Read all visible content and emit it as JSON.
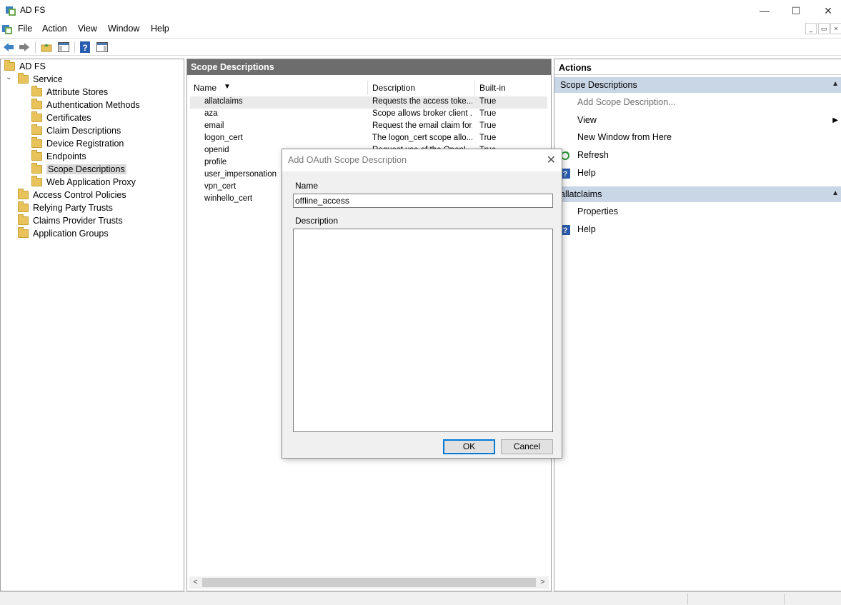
{
  "window": {
    "title": "AD FS",
    "minimize_glyph": "—",
    "maximize_glyph": "☐",
    "close_glyph": "✕"
  },
  "menu": {
    "items": [
      "File",
      "Action",
      "View",
      "Window",
      "Help"
    ]
  },
  "mdi": {
    "minimize_glyph": "_",
    "restore_glyph": "▭",
    "close_glyph": "×"
  },
  "tree": {
    "root": "AD FS",
    "service": "Service",
    "service_children": [
      "Attribute Stores",
      "Authentication Methods",
      "Certificates",
      "Claim Descriptions",
      "Device Registration",
      "Endpoints",
      "Scope Descriptions",
      "Web Application Proxy"
    ],
    "top_level": [
      "Access Control Policies",
      "Relying Party Trusts",
      "Claims Provider Trusts",
      "Application Groups"
    ],
    "selected": "Scope Descriptions"
  },
  "center": {
    "header": "Scope Descriptions",
    "columns": [
      "Name",
      "Description",
      "Built-in"
    ],
    "sort_glyph": "▼",
    "rows": [
      {
        "name": "allatclaims",
        "description": "Requests the access toke...",
        "builtin": "True"
      },
      {
        "name": "aza",
        "description": "Scope allows broker client ...",
        "builtin": "True"
      },
      {
        "name": "email",
        "description": "Request the email claim for...",
        "builtin": "True"
      },
      {
        "name": "logon_cert",
        "description": "The logon_cert scope allo...",
        "builtin": "True"
      },
      {
        "name": "openid",
        "description": "Request use of the OpenI...",
        "builtin": "True"
      },
      {
        "name": "profile",
        "description": "",
        "builtin": ""
      },
      {
        "name": "user_impersonation",
        "description": "",
        "builtin": ""
      },
      {
        "name": "vpn_cert",
        "description": "",
        "builtin": ""
      },
      {
        "name": "winhello_cert",
        "description": "",
        "builtin": ""
      }
    ],
    "scroll_left": "<",
    "scroll_right": ">"
  },
  "actions": {
    "title": "Actions",
    "section1": {
      "title": "Scope Descriptions",
      "items": [
        "Add Scope Description...",
        "View",
        "New Window from Here",
        "Refresh",
        "Help"
      ]
    },
    "section2": {
      "title": "allatclaims",
      "items": [
        "Properties",
        "Help"
      ]
    },
    "caret_up": "▲",
    "submenu_arrow": "▶"
  },
  "dialog": {
    "title": "Add OAuth Scope Description",
    "close_glyph": "✕",
    "name_label": "Name",
    "name_value": "offline_access",
    "description_label": "Description",
    "ok_label": "OK",
    "cancel_label": "Cancel"
  },
  "colors": {
    "header_gray": "#6d6d6d",
    "section_blue": "#c8d6e6",
    "focus_blue": "#0078d7"
  }
}
